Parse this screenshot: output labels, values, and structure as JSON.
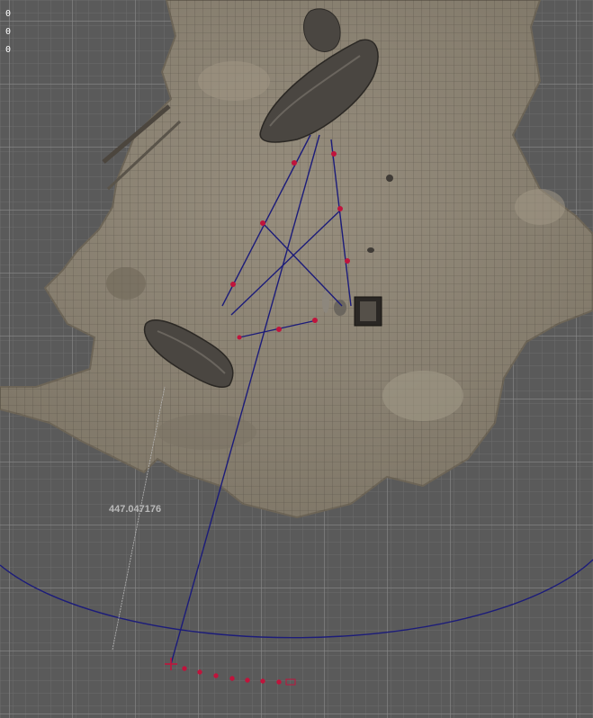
{
  "viewport": {
    "coordinates": [
      "0",
      "0",
      "0"
    ],
    "measurement_value": "447.047176"
  },
  "colors": {
    "background": "#5a5a5a",
    "grid_major": "#8a8a8a",
    "grid_minor": "#6c6c6c",
    "terrain": "#8e8576",
    "terrain_shadow": "#6d6557",
    "rock": "#4a4641",
    "construction_line": "#1c1c7a",
    "marker": "#c0143c"
  }
}
